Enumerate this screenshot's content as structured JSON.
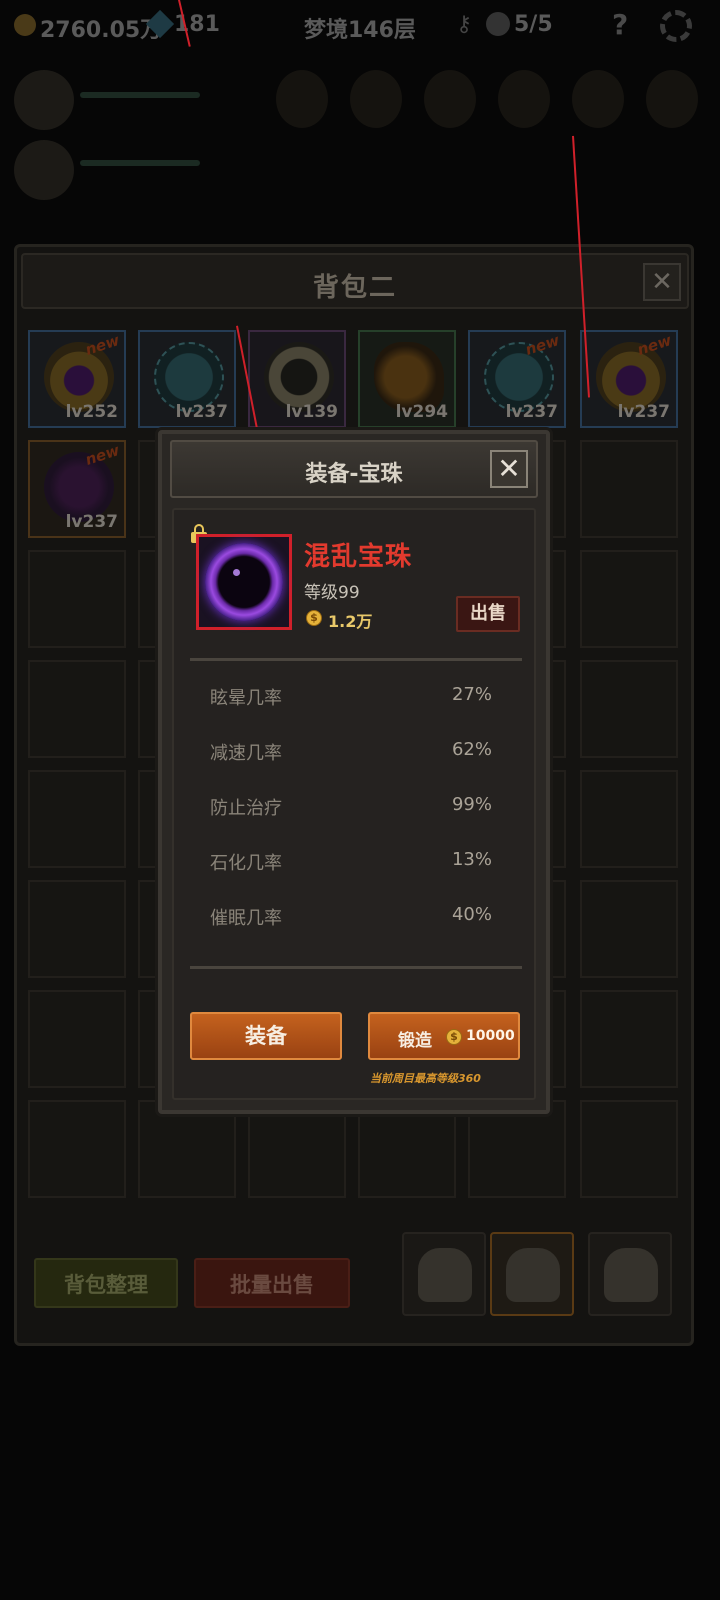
{
  "hud": {
    "gold": "2760.05万",
    "gems": "181",
    "floor": "梦境146层",
    "skulls": "5/5",
    "help": "?"
  },
  "bag": {
    "title": "背包二",
    "close": "✕",
    "slots_row1": [
      {
        "level": "lv252",
        "icon": "gold-orb",
        "new": "new",
        "frame": "blue"
      },
      {
        "level": "lv237",
        "icon": "net-orb",
        "new": "",
        "frame": "blue"
      },
      {
        "level": "lv139",
        "icon": "ring",
        "new": "",
        "frame": "purple"
      },
      {
        "level": "lv294",
        "icon": "flame",
        "new": "",
        "frame": "green"
      },
      {
        "level": "lv237",
        "icon": "net-orb",
        "new": "new",
        "frame": "blue"
      },
      {
        "level": "lv237",
        "icon": "gold-orb",
        "new": "new",
        "frame": "blue"
      }
    ],
    "slot_row2_first": {
      "level": "lv237",
      "icon": "dark-orb",
      "new": "new",
      "frame": "orange"
    },
    "sort_button": "背包整理",
    "batch_sell_button": "批量出售"
  },
  "modal": {
    "title": "装备-宝珠",
    "close": "✕",
    "item_name": "混乱宝珠",
    "item_level": "等级99",
    "price": "1.2万",
    "sell_button": "出售",
    "stats": [
      {
        "label": "眩晕几率",
        "value": "27%"
      },
      {
        "label": "减速几率",
        "value": "62%"
      },
      {
        "label": "防止治疗",
        "value": "99%"
      },
      {
        "label": "石化几率",
        "value": "13%"
      },
      {
        "label": "催眠几率",
        "value": "40%"
      }
    ],
    "equip_button": "装备",
    "forge_button": "锻造",
    "forge_cost": "10000",
    "max_level_note": "当前周目最高等级360"
  },
  "colors": {
    "item_name": "#e23a2e",
    "price": "#e9c96a",
    "action_button": "#c4621e",
    "highlight_frame": "#d0202a"
  }
}
